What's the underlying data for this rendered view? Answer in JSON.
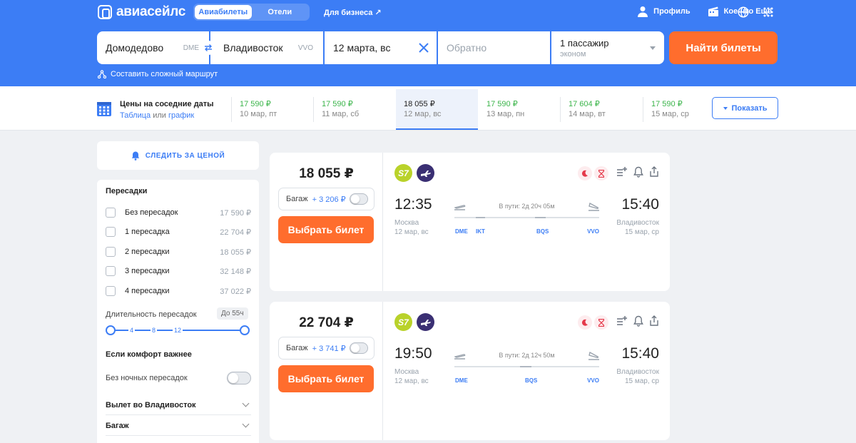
{
  "header": {
    "logo": "авиасейлс",
    "product_tabs": [
      "Авиабилеты",
      "Отели"
    ],
    "business_link": "Для бизнеса ↗",
    "profile": "Профиль",
    "more": "Кое-что Ещё"
  },
  "search": {
    "origin": "Домодедово",
    "origin_code": "DME",
    "destination": "Владивосток",
    "destination_code": "VVO",
    "depart_date": "12 марта, вс",
    "return_placeholder": "Обратно",
    "passengers": "1 пассажир",
    "cabin": "эконом",
    "submit": "Найти билеты",
    "complex_route": "Составить сложный маршрут"
  },
  "date_strip": {
    "title": "Цены на соседние даты",
    "sub_table": "Таблица",
    "sub_or": "или",
    "sub_chart": "график",
    "cells": [
      {
        "price": "17 590 ₽",
        "date": "10 мар, пт"
      },
      {
        "price": "17 590 ₽",
        "date": "11 мар, сб"
      },
      {
        "price": "18 055 ₽",
        "date": "12 мар, вс"
      },
      {
        "price": "17 590 ₽",
        "date": "13 мар, пн"
      },
      {
        "price": "17 604 ₽",
        "date": "14 мар, вт"
      },
      {
        "price": "17 590 ₽",
        "date": "15 мар, ср"
      }
    ],
    "selected_index": 2,
    "show_button": "Показать"
  },
  "sidebar": {
    "watch_price": "СЛЕДИТЬ ЗА ЦЕНОЙ",
    "stops_title": "Пересадки",
    "stops": [
      {
        "label": "Без пересадок",
        "price": "17 590 ₽"
      },
      {
        "label": "1 пересадка",
        "price": "22 704 ₽"
      },
      {
        "label": "2 пересадки",
        "price": "18 055 ₽"
      },
      {
        "label": "3 пересадки",
        "price": "32 148 ₽"
      },
      {
        "label": "4 пересадки",
        "price": "37 022 ₽"
      }
    ],
    "duration_label": "Длительность пересадок",
    "duration_badge": "До 55ч",
    "duration_ticks": [
      "4",
      "8",
      "12"
    ],
    "comfort_title": "Если комфорт важнее",
    "no_night": "Без ночных пересадок",
    "accordions": [
      "Вылет во Владивосток",
      "Багаж"
    ]
  },
  "tickets": [
    {
      "price": "18 055 ₽",
      "bag_label": "Багаж",
      "bag_extra": "+ 3 206 ₽",
      "buy": "Выбрать билет",
      "airline1": "S7",
      "dep_time": "12:35",
      "dep_city": "Москва",
      "dep_date": "12 мар, вс",
      "arr_time": "15:40",
      "arr_city": "Владивосток",
      "arr_date": "15 мар, ср",
      "duration": "В пути: 2д 20ч 05м",
      "codes": [
        "DME",
        "IKT",
        "BQS",
        "VVO"
      ]
    },
    {
      "price": "22 704 ₽",
      "bag_label": "Багаж",
      "bag_extra": "+ 3 741 ₽",
      "buy": "Выбрать билет",
      "airline1": "S7",
      "dep_time": "19:50",
      "dep_city": "Москва",
      "dep_date": "12 мар, вс",
      "arr_time": "15:40",
      "arr_city": "Владивосток",
      "arr_date": "15 мар, ср",
      "duration": "В пути: 2д 12ч 50м",
      "codes": [
        "DME",
        "BQS",
        "VVO"
      ]
    }
  ],
  "colors": {
    "brand": "#3c7df5",
    "accent": "#ff6d2d",
    "price_green": "#3cb54b"
  }
}
